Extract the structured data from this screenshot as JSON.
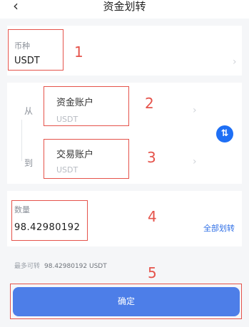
{
  "header": {
    "title": "资金划转",
    "back_icon": "chevron-left-icon"
  },
  "currency": {
    "label": "币种",
    "value": "USDT"
  },
  "transfer": {
    "from_label": "从",
    "to_label": "到",
    "from_account": {
      "name": "资金账户",
      "currency": "USDT"
    },
    "to_account": {
      "name": "交易账户",
      "currency": "USDT"
    },
    "swap_icon": "swap-vertical-icon"
  },
  "amount": {
    "label": "数量",
    "value": "98.42980192",
    "transfer_all_label": "全部划转"
  },
  "max_transferable": {
    "label": "最多可转",
    "value": "98.42980192 USDT"
  },
  "confirm_label": "确定",
  "annotations": [
    "1",
    "2",
    "3",
    "4",
    "5"
  ],
  "colors": {
    "accent": "#1e6ff5",
    "button": "#4d7ee8",
    "annotation": "#e5534b",
    "link": "#2f6fe6"
  }
}
